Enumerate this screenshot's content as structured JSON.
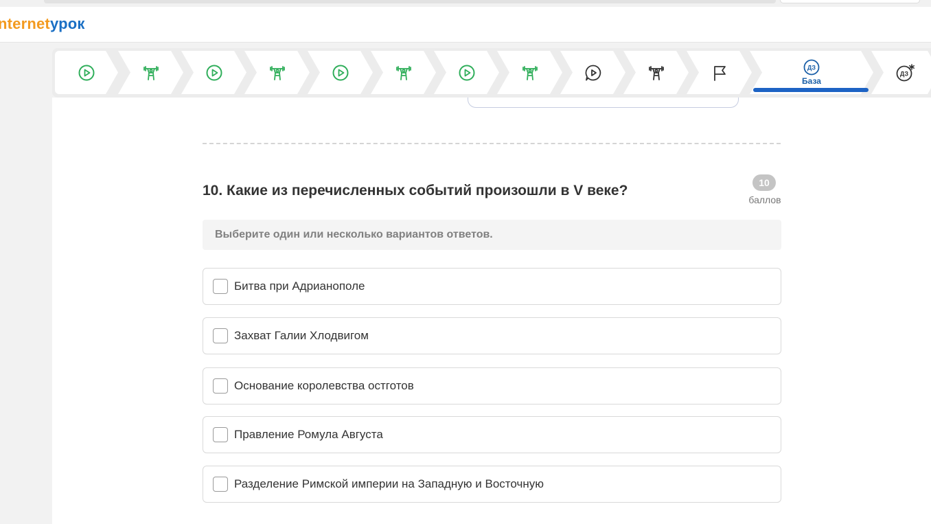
{
  "brand": {
    "part1": "nternet",
    "part2": "урок"
  },
  "lesson_steps": [
    {
      "icon": "video-play-icon",
      "color": "#2fae5a"
    },
    {
      "icon": "workout-icon",
      "color": "#2fae5a"
    },
    {
      "icon": "video-play-icon",
      "color": "#2fae5a"
    },
    {
      "icon": "workout-icon",
      "color": "#2fae5a"
    },
    {
      "icon": "video-play-icon",
      "color": "#2fae5a"
    },
    {
      "icon": "workout-icon",
      "color": "#2fae5a"
    },
    {
      "icon": "video-play-icon",
      "color": "#2fae5a"
    },
    {
      "icon": "workout-icon",
      "color": "#2fae5a"
    },
    {
      "icon": "chat-play-icon",
      "color": "#333333"
    },
    {
      "icon": "workout-icon",
      "color": "#333333"
    },
    {
      "icon": "finish-flag-icon",
      "color": "#333333"
    },
    {
      "icon": "homework-icon",
      "badge": "ДЗ",
      "label": "База",
      "color": "#1a5fa8",
      "active": true
    },
    {
      "icon": "homework-extra-icon",
      "badge": "ДЗ",
      "color": "#333333"
    }
  ],
  "question": {
    "title": "10. Какие из перечисленных событий произошли в V веке?",
    "points_value": "10",
    "points_label": "баллов",
    "instruction": "Выберите один или несколько вариантов ответов.",
    "options": [
      {
        "label": "Битва при Адрианополе",
        "checked": false
      },
      {
        "label": "Захват Галии Хлодвигом",
        "checked": false
      },
      {
        "label": "Основание королевства остготов",
        "checked": false
      },
      {
        "label": "Правление Ромула Августа",
        "checked": false
      },
      {
        "label": "Разделение Римской империи на Западную и Восточную",
        "checked": false
      }
    ]
  },
  "colors": {
    "accent": "#1d63c4",
    "success": "#2fae5a",
    "brand_orange": "#f39a1f",
    "brand_blue": "#1a6fc4"
  }
}
